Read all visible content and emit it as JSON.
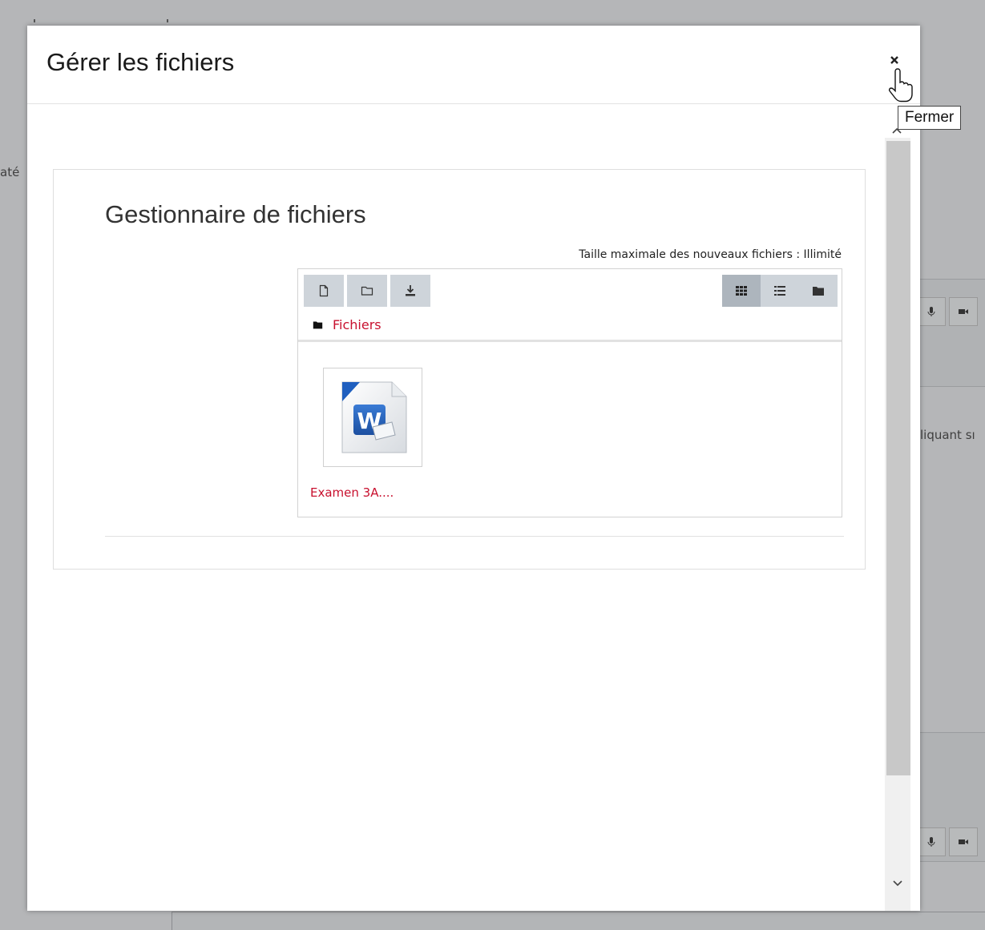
{
  "background": {
    "left_text": "até",
    "right_text": "liquant sı"
  },
  "modal": {
    "title": "Gérer les fichiers",
    "close_tooltip": "Fermer"
  },
  "filemanager": {
    "title": "Gestionnaire de fichiers",
    "max_size": "Taille maximale des nouveaux fichiers : Illimité",
    "toolbar": {
      "left_icons": [
        "file-add-icon",
        "folder-add-icon",
        "download-icon"
      ],
      "right_icons": [
        "grid-view-icon",
        "list-view-icon",
        "tree-view-icon"
      ],
      "active_view": "grid-view-icon"
    },
    "path": {
      "label": "Fichiers"
    },
    "files": [
      {
        "name": "Examen 3A....",
        "icon": "word-document-icon"
      }
    ]
  },
  "colors": {
    "link": "#c8102e",
    "toolbar_btn": "#ced4da",
    "toolbar_btn_active": "#adb5bd",
    "overlay": "#b5b6b8"
  }
}
